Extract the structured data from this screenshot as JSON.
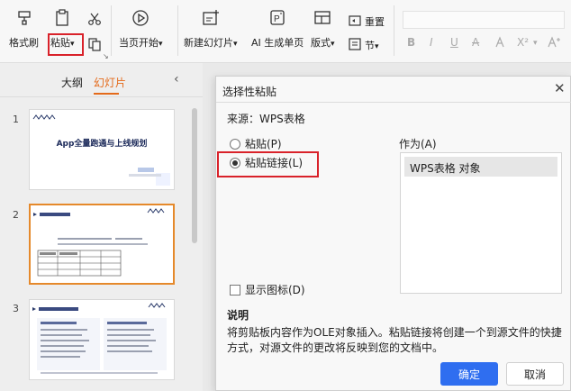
{
  "ribbon": {
    "format_painter": "格式刷",
    "paste": "粘贴",
    "paste_arrow": "▾",
    "from_current": "当页开始",
    "from_current_arrow": "▾",
    "new_slide": "新建幻灯片",
    "new_slide_arrow": "▾",
    "ai_generate": "AI 生成单页",
    "layout": "版式",
    "layout_arrow": "▾",
    "reset": "重置",
    "section": "节",
    "section_arrow": "▾",
    "clipboard_corner": "↘",
    "format": {
      "bold": "B",
      "italic": "I",
      "underline": "U",
      "strike": "A",
      "sup": "X²",
      "more": "▾"
    }
  },
  "left_panel": {
    "tabs": [
      "大纲",
      "幻灯片"
    ],
    "active_tab": 1,
    "slides": [
      {
        "number": "1",
        "title": "App全量跑通与上线规划",
        "subtitle": ""
      },
      {
        "number": "2",
        "title": ""
      },
      {
        "number": "3",
        "title": ""
      }
    ]
  },
  "dialog": {
    "title": "选择性粘贴",
    "close": "✕",
    "source_label": "来源：WPS表格",
    "option_paste": "粘贴(P)",
    "option_paste_link": "粘贴链接(L)",
    "selected_option": "paste_link",
    "as_label": "作为(A)",
    "as_items": [
      "WPS表格 对象"
    ],
    "show_icon_label": "显示图标(D)",
    "desc_title": "说明",
    "desc_text": "将剪贴板内容作为OLE对象插入。粘贴链接将创建一个到源文件的快捷方式，对源文件的更改将反映到您的文档中。",
    "ok": "确定",
    "cancel": "取消"
  },
  "colors": {
    "accent": "#e46a1a",
    "highlight": "#d9222a",
    "primary_button": "#2f6ef0"
  }
}
